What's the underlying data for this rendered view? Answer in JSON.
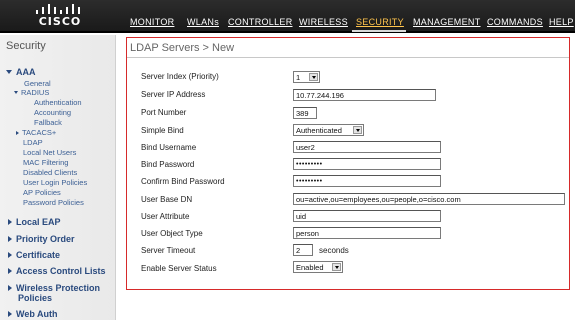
{
  "brand": {
    "logo_text": "CISCO"
  },
  "nav": {
    "items": [
      {
        "id": "monitor",
        "label": "MONITOR"
      },
      {
        "id": "wlans",
        "label": "WLANs"
      },
      {
        "id": "controller",
        "label": "CONTROLLER"
      },
      {
        "id": "wireless",
        "label": "WIRELESS"
      },
      {
        "id": "security",
        "label": "SECURITY",
        "active": true
      },
      {
        "id": "management",
        "label": "MANAGEMENT"
      },
      {
        "id": "commands",
        "label": "COMMANDS"
      },
      {
        "id": "help",
        "label": "HELP"
      }
    ]
  },
  "sidebar": {
    "title": "Security",
    "aaa": {
      "label": "AAA",
      "general": "General",
      "radius": "RADIUS",
      "authentication": "Authentication",
      "accounting": "Accounting",
      "fallback": "Fallback",
      "tacacs": "TACACS+",
      "ldap": "LDAP",
      "local_net_users": "Local Net Users",
      "mac_filtering": "MAC Filtering",
      "disabled_clients": "Disabled Clients",
      "user_login_policies": "User Login Policies",
      "ap_policies": "AP Policies",
      "password_policies": "Password Policies"
    },
    "sections": {
      "local_eap": "Local EAP",
      "priority_order": "Priority Order",
      "certificate": "Certificate",
      "access_control_lists": "Access Control Lists",
      "wireless_protection_line1": "Wireless Protection",
      "wireless_protection_line2": "Policies",
      "web_auth": "Web Auth"
    }
  },
  "page": {
    "title": "LDAP Servers > New"
  },
  "form": {
    "server_index": {
      "label": "Server Index (Priority)",
      "value": "1"
    },
    "server_ip": {
      "label": "Server IP Address",
      "value": "10.77.244.196"
    },
    "port_number": {
      "label": "Port Number",
      "value": "389"
    },
    "simple_bind": {
      "label": "Simple Bind",
      "value": "Authenticated"
    },
    "bind_username": {
      "label": "Bind Username",
      "value": "user2"
    },
    "bind_password": {
      "label": "Bind Password",
      "value": "•••••••••"
    },
    "confirm_bind_password": {
      "label": "Confirm Bind Password",
      "value": "•••••••••"
    },
    "user_base_dn": {
      "label": "User Base DN",
      "value": "ou=active,ou=employees,ou=people,o=cisco.com"
    },
    "user_attribute": {
      "label": "User Attribute",
      "value": "uid"
    },
    "user_object_type": {
      "label": "User Object Type",
      "value": "person"
    },
    "server_timeout": {
      "label": "Server Timeout",
      "value": "2",
      "unit": "seconds"
    },
    "enable_server_status": {
      "label": "Enable Server Status",
      "value": "Enabled"
    }
  },
  "colors": {
    "active_nav": "#ffc44d",
    "panel_border": "#d62a2a",
    "sidebar_link": "#2a4a7e"
  }
}
